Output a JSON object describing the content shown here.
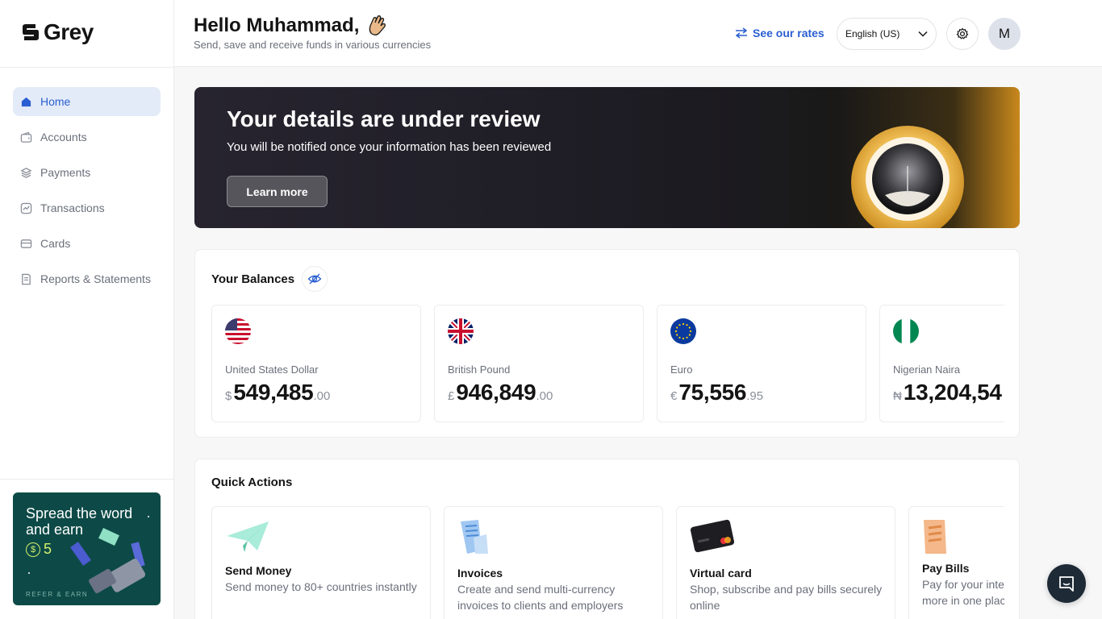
{
  "app": {
    "logo_text": "Grey"
  },
  "sidebar": {
    "items": [
      {
        "label": "Home",
        "icon": "home-icon",
        "active": true
      },
      {
        "label": "Accounts",
        "icon": "wallet-icon"
      },
      {
        "label": "Payments",
        "icon": "layers-icon"
      },
      {
        "label": "Transactions",
        "icon": "chart-icon"
      },
      {
        "label": "Cards",
        "icon": "card-icon"
      },
      {
        "label": "Reports & Statements",
        "icon": "report-icon"
      }
    ],
    "referral": {
      "line1": "Spread the word",
      "line2": "and earn",
      "amount": "5",
      "coin_symbol": "$",
      "footer": "REFER & EARN"
    }
  },
  "header": {
    "greeting": "Hello Muhammad,",
    "subtitle": "Send, save and receive funds in various currencies",
    "rates_link": "See our rates",
    "language": "English (US)",
    "avatar_initial": "M"
  },
  "banner": {
    "title": "Your details are under review",
    "subtitle": "You will be notified once your information has been reviewed",
    "button": "Learn more"
  },
  "balances": {
    "title": "Your Balances",
    "items": [
      {
        "name": "United States Dollar",
        "symbol": "$",
        "integer": "549,485",
        "decimal": ".00",
        "flag": "us-flag-icon"
      },
      {
        "name": "British Pound",
        "symbol": "£",
        "integer": "946,849",
        "decimal": ".00",
        "flag": "uk-flag-icon"
      },
      {
        "name": "Euro",
        "symbol": "€",
        "integer": "75,556",
        "decimal": ".95",
        "flag": "eu-flag-icon"
      },
      {
        "name": "Nigerian Naira",
        "symbol": "₦",
        "integer": "13,204,54",
        "decimal": "",
        "flag": "ng-flag-icon"
      }
    ]
  },
  "quick_actions": {
    "title": "Quick Actions",
    "items": [
      {
        "title": "Send Money",
        "desc": "Send money to 80+ countries instantly"
      },
      {
        "title": "Invoices",
        "desc": "Create and send multi-currency invoices to clients and employers"
      },
      {
        "title": "Virtual card",
        "desc": "Shop, subscribe and pay bills securely online"
      },
      {
        "title": "Pay Bills",
        "desc": "Pay for your internet, subscription and more in one place"
      }
    ]
  },
  "colors": {
    "accent": "#2a5fd1",
    "active_nav_bg": "#e3ebf8",
    "referral_bg": "#0d4a47",
    "referral_accent": "#d6f06d"
  }
}
